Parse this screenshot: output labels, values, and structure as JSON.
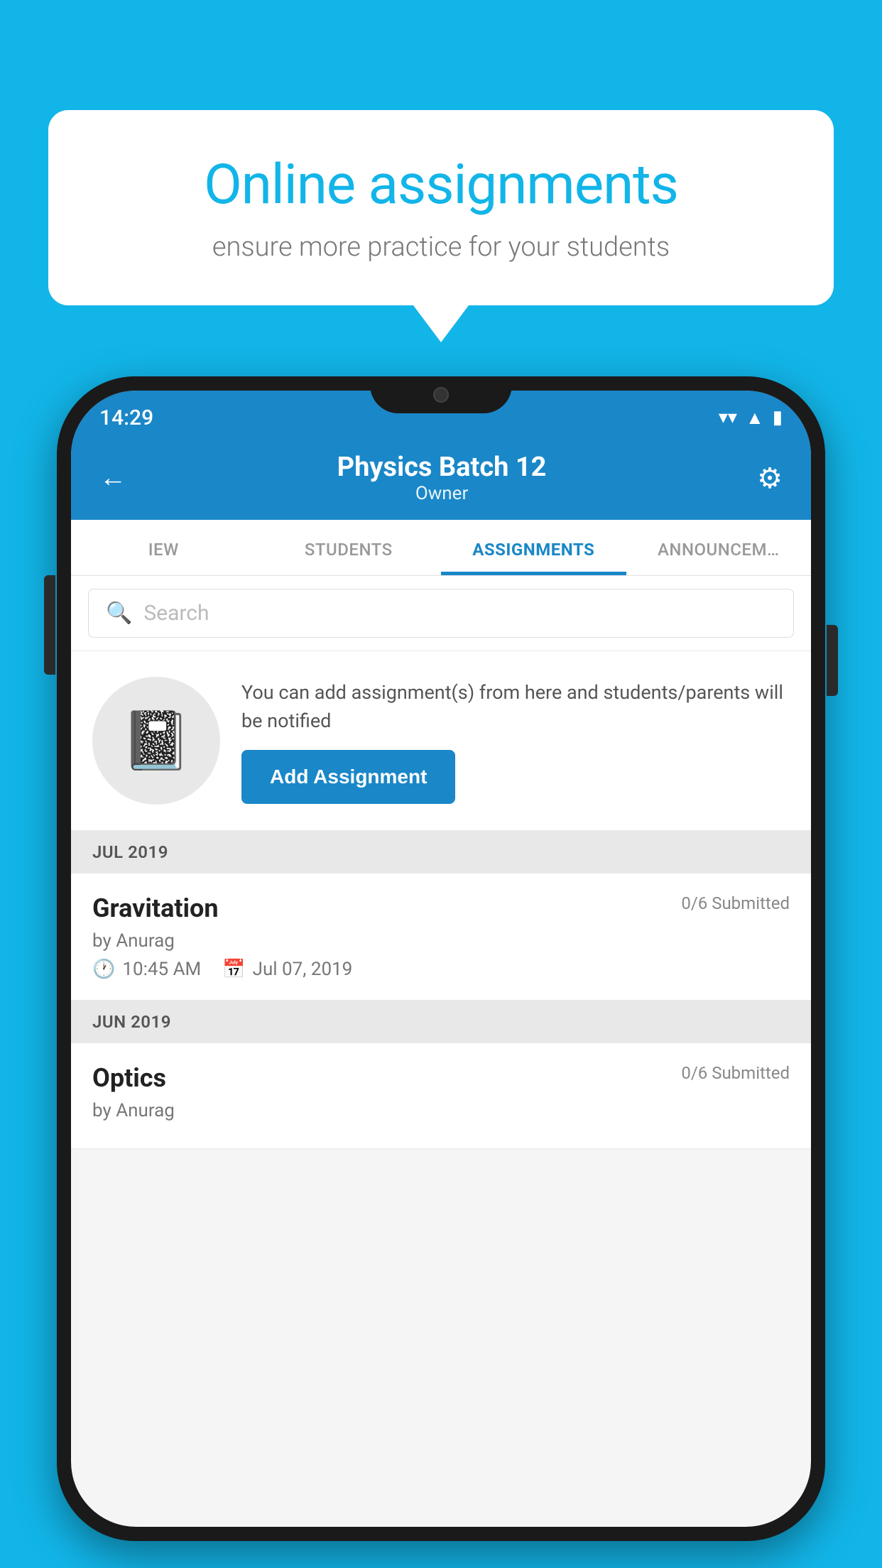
{
  "background_color": "#12B5E8",
  "bubble": {
    "title": "Online assignments",
    "subtitle": "ensure more practice for your students"
  },
  "status_bar": {
    "time": "14:29",
    "wifi": "▼",
    "signal": "▲",
    "battery": "▮"
  },
  "header": {
    "title": "Physics Batch 12",
    "subtitle": "Owner",
    "back_label": "←",
    "settings_label": "⚙"
  },
  "tabs": [
    {
      "label": "IEW",
      "active": false
    },
    {
      "label": "STUDENTS",
      "active": false
    },
    {
      "label": "ASSIGNMENTS",
      "active": true
    },
    {
      "label": "ANNOUNCEM…",
      "active": false
    }
  ],
  "search": {
    "placeholder": "Search"
  },
  "promo": {
    "icon": "📓",
    "text": "You can add assignment(s) from here and students/parents will be notified",
    "button_label": "Add Assignment"
  },
  "sections": [
    {
      "header": "JUL 2019",
      "assignments": [
        {
          "name": "Gravitation",
          "submitted": "0/6 Submitted",
          "by": "by Anurag",
          "time": "10:45 AM",
          "date": "Jul 07, 2019"
        }
      ]
    },
    {
      "header": "JUN 2019",
      "assignments": [
        {
          "name": "Optics",
          "submitted": "0/6 Submitted",
          "by": "by Anurag",
          "time": "",
          "date": ""
        }
      ]
    }
  ]
}
